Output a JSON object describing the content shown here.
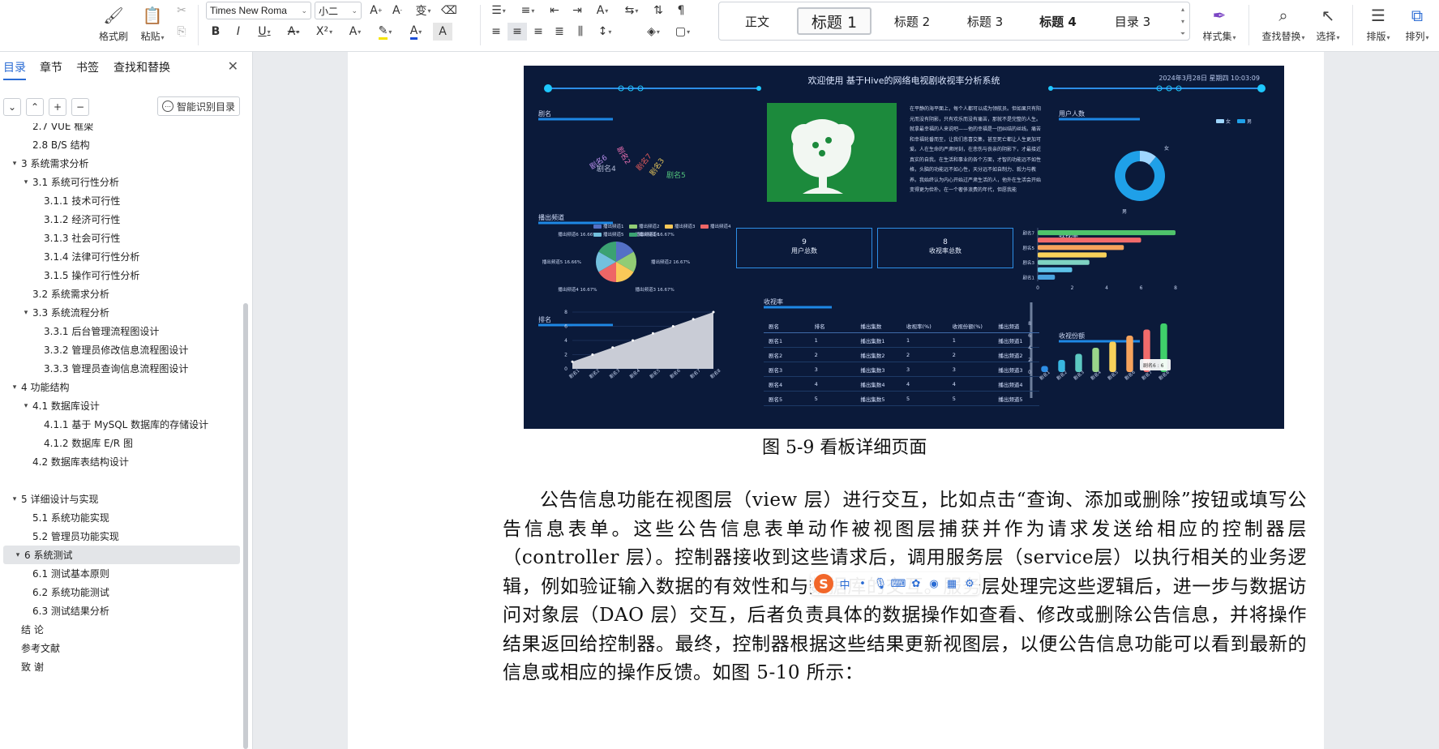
{
  "ribbon": {
    "format_painter": "格式刷",
    "paste": "粘贴",
    "font_name": "Times New Roma",
    "font_size": "小二",
    "style_set": "样式集",
    "find_replace": "查找替换",
    "select": "选择",
    "layout": "排版",
    "arrange": "排列",
    "styles": [
      "正文",
      "标题 1",
      "标题 2",
      "标题 3",
      "标题 4",
      "目录 3"
    ]
  },
  "nav": {
    "tabs": [
      "目录",
      "章节",
      "书签",
      "查找和替换"
    ],
    "active_tab": "目录",
    "smart_button": "智能识别目录",
    "toc": [
      {
        "label": "2.7 VUE 框架",
        "level": 2,
        "toggle": false
      },
      {
        "label": "2.8 B/S 结构",
        "level": 2,
        "toggle": false
      },
      {
        "label": "3 系统需求分析",
        "level": 1,
        "toggle": true
      },
      {
        "label": "3.1 系统可行性分析",
        "level": 2,
        "toggle": true
      },
      {
        "label": "3.1.1 技术可行性",
        "level": 3,
        "toggle": false
      },
      {
        "label": "3.1.2 经济可行性",
        "level": 3,
        "toggle": false
      },
      {
        "label": "3.1.3 社会可行性",
        "level": 3,
        "toggle": false
      },
      {
        "label": "3.1.4 法律可行性分析",
        "level": 3,
        "toggle": false
      },
      {
        "label": "3.1.5 操作可行性分析",
        "level": 3,
        "toggle": false
      },
      {
        "label": "3.2  系统需求分析",
        "level": 2,
        "toggle": false
      },
      {
        "label": "3.3  系统流程分析",
        "level": 2,
        "toggle": true
      },
      {
        "label": "3.3.1 后台管理流程图设计",
        "level": 3,
        "toggle": false
      },
      {
        "label": "3.3.2 管理员修改信息流程图设计",
        "level": 3,
        "toggle": false
      },
      {
        "label": "3.3.3 管理员查询信息流程图设计",
        "level": 3,
        "toggle": false
      },
      {
        "label": "4 功能结构",
        "level": 1,
        "toggle": true
      },
      {
        "label": "4.1  数据库设计",
        "level": 2,
        "toggle": true
      },
      {
        "label": "4.1.1  基于 MySQL 数据库的存储设计",
        "level": 3,
        "toggle": false
      },
      {
        "label": "4.1.2  数据库 E/R 图",
        "level": 3,
        "toggle": false
      },
      {
        "label": "4.2  数据库表结构设计",
        "level": 2,
        "toggle": false
      },
      {
        "label": "",
        "level": 0,
        "toggle": false
      },
      {
        "label": "5 详细设计与实现",
        "level": 1,
        "toggle": true
      },
      {
        "label": "5.1 系统功能实现",
        "level": 2,
        "toggle": false
      },
      {
        "label": "5.2 管理员功能实现",
        "level": 2,
        "toggle": false
      },
      {
        "label": "6  系统测试",
        "level": 1,
        "toggle": true,
        "selected": true
      },
      {
        "label": "6.1  测试基本原则",
        "level": 2,
        "toggle": false
      },
      {
        "label": "6.2  系统功能测试",
        "level": 2,
        "toggle": false
      },
      {
        "label": "6.3 测试结果分析",
        "level": 2,
        "toggle": false
      },
      {
        "label": "结   论",
        "level": 1,
        "toggle": false
      },
      {
        "label": "参考文献",
        "level": 1,
        "toggle": false
      },
      {
        "label": "致   谢",
        "level": 1,
        "toggle": false
      }
    ]
  },
  "dashboard": {
    "title": "欢迎使用 基于Hive的网络电视剧收视率分析系统",
    "datetime": "2024年3月28日 星期四 10:03:09",
    "panels": {
      "drama_name": "剧名",
      "channel": "播出频道",
      "rank": "排名",
      "user_count": "用户人数",
      "rating": "收视率",
      "rating_table": "收视率",
      "share": "收视份额"
    },
    "word_cloud": [
      "剧名6",
      "剧名4",
      "剧名2",
      "剧名7",
      "剧名3",
      "剧名5"
    ],
    "intro_text": "在平静的海平面上，每个人都可以成为领航员。但如果只有阳光而没有阴影，只有欢乐而没有痛苦，那就不是完整的人生。就拿最幸福的人来说吧——他的幸福是一团纠结的丝线。痛苦和幸福轮番而至，让我们悲喜交集，甚至死亡都让人生更加可爱。人在生命的严肃时刻，在悲伤与丧亲的阴影下，才最接近真实的自我。在生活和事业的各个方面，才智的功能远不如性格，头脑的功能远不如心性，天分远不如自制力、毅力与教养。我始终认为内心开始过严肃生活的人，他外在生活会开始变得更为俭朴。在一个奢侈浪费的年代，但愿我能",
    "kpis": [
      {
        "value": "9",
        "label": "用户总数"
      },
      {
        "value": "8",
        "label": "收视率总数"
      }
    ],
    "table_headers": [
      "剧名",
      "排名",
      "播出集数",
      "收视率(%)",
      "收视份额(%)",
      "播出频道"
    ],
    "table_rows": [
      [
        "剧名1",
        "1",
        "播出集数1",
        "1",
        "1",
        "播出频道1"
      ],
      [
        "剧名2",
        "2",
        "播出集数2",
        "2",
        "2",
        "播出频道2"
      ],
      [
        "剧名3",
        "3",
        "播出集数3",
        "3",
        "3",
        "播出频道3"
      ],
      [
        "剧名4",
        "4",
        "播出集数4",
        "4",
        "4",
        "播出频道4"
      ],
      [
        "剧名5",
        "5",
        "播出集数5",
        "5",
        "5",
        "播出频道5"
      ]
    ],
    "share_tooltip": "剧名6 : 6",
    "gender_legend": [
      "女",
      "男"
    ],
    "gender_labels": [
      "女",
      "男"
    ],
    "colors": {
      "bg": "#0b1a3a",
      "accent": "#2d8ee6",
      "tree_bg": "#1c8a3c"
    }
  },
  "chart_data": [
    {
      "type": "pie",
      "title": "播出频道",
      "categories": [
        "播出频道1",
        "播出频道2",
        "播出频道3",
        "播出频道4",
        "播出频道5",
        "播出频道6"
      ],
      "values": [
        16.67,
        16.67,
        16.67,
        16.67,
        16.66,
        16.66
      ],
      "slice_labels": [
        "播出频道1 16.67%",
        "播出频道2 16.67%",
        "播出频道3 16.67%",
        "播出频道4 16.67%",
        "播出频道5 16.66%",
        "播出频道6 16.66%"
      ],
      "colors": [
        "#5470c6",
        "#91cc75",
        "#fac858",
        "#ee6666",
        "#73c0de",
        "#3ba272"
      ]
    },
    {
      "type": "area",
      "title": "排名",
      "categories": [
        "剧名1",
        "剧名2",
        "剧名3",
        "剧名4",
        "剧名5",
        "剧名6",
        "剧名7",
        "剧名8"
      ],
      "values": [
        1,
        2,
        3,
        4,
        5,
        6,
        7,
        8
      ],
      "ylim": [
        0,
        8
      ],
      "yticks": [
        "0",
        "2",
        "4",
        "6",
        "8"
      ]
    },
    {
      "type": "pie",
      "title": "用户人数",
      "categories": [
        "女",
        "男"
      ],
      "values": [
        1,
        8
      ],
      "colors": [
        "#9fd6ff",
        "#1fa0e8"
      ]
    },
    {
      "type": "bar",
      "title": "收视率",
      "orientation": "horizontal",
      "categories": [
        "剧名1",
        "剧名2",
        "剧名3",
        "剧名4",
        "剧名5",
        "剧名6",
        "剧名7"
      ],
      "values": [
        1,
        2,
        3,
        4,
        5,
        6,
        8
      ],
      "tick_labels": [
        "剧名1",
        "剧名3",
        "剧名5",
        "剧名7"
      ],
      "xticks": [
        "0",
        "2",
        "4",
        "6",
        "8"
      ],
      "xlim": [
        0,
        8
      ],
      "colors": [
        "#4aa3df",
        "#5dc2e8",
        "#7fd3c2",
        "#f8d15a",
        "#f7a35c",
        "#f26b6b",
        "#4fc36b"
      ]
    },
    {
      "type": "bar",
      "title": "收视份额",
      "categories": [
        "剧名1",
        "剧名2",
        "剧名3",
        "剧名4",
        "剧名5",
        "剧名6",
        "剧名7",
        "剧名8"
      ],
      "values": [
        1,
        2,
        3,
        4,
        5,
        6,
        7,
        8
      ],
      "ylim": [
        0,
        8
      ],
      "yticks": [
        "0",
        "2",
        "4",
        "6",
        "8"
      ],
      "colors": [
        "#2d8ee6",
        "#38b6e0",
        "#5dc9c2",
        "#9ad58a",
        "#f8d15a",
        "#f7a35c",
        "#f26b6b",
        "#3fcf6a"
      ]
    }
  ],
  "document": {
    "caption": "图 5-9 看板详细页面",
    "paragraph": "公告信息功能在视图层（view 层）进行交互，比如点击“查询、添加或删除”按钮或填写公告信息表单。这些公告信息表单动作被视图层捕获并作为请求发送给相应的控制器层（controller 层）。控制器接收到这些请求后，调用服务层（service层）以执行相关的业务逻辑，例如验证输入数据的有效性和与数据库的交互。服务层处理完这些逻辑后，进一步与数据访问对象层（DAO 层）交互，后者负责具体的数据操作如查看、修改或删除公告信息，并将操作结果返回给控制器。最终，控制器根据这些结果更新视图层，以便公告信息功能可以看到最新的信息或相应的操作反馈。如图 5-10 所示："
  },
  "ime": {
    "lang": "中"
  }
}
